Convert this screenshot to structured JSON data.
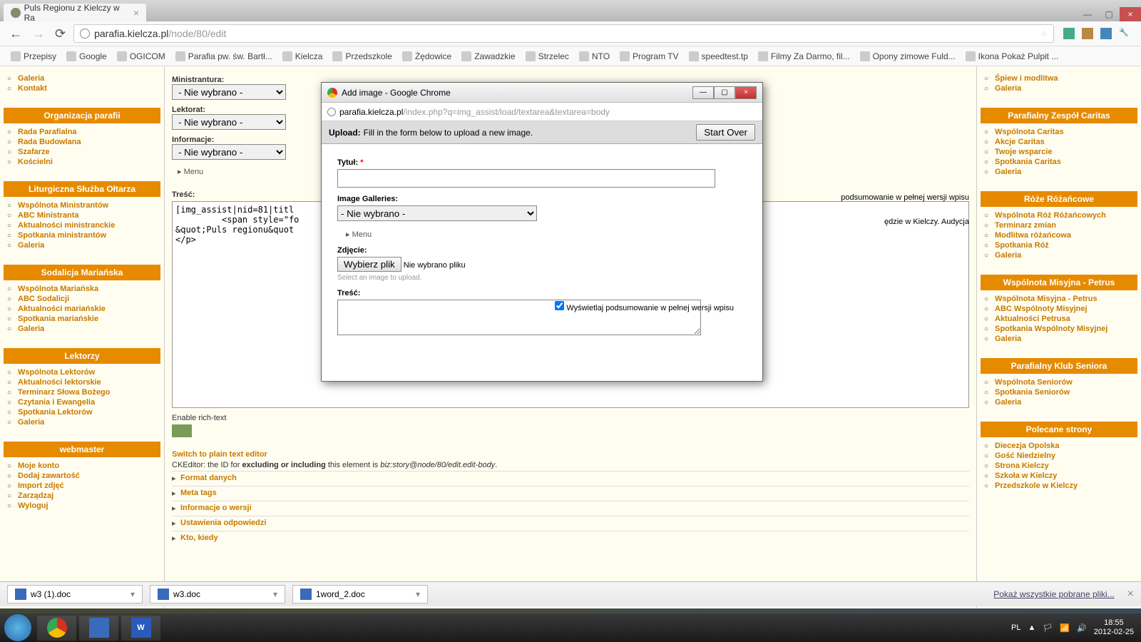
{
  "browser": {
    "tab_title": "Puls Regionu z Kielczy w Ra",
    "url_host": "parafia.kielcza.pl",
    "url_path": "/node/80/edit",
    "win_min": "—",
    "win_max": "▢",
    "win_close": "×"
  },
  "bookmarks": [
    "Przepisy",
    "Google",
    "OGICOM",
    "Parafia pw. św. Bartł...",
    "Kielcza",
    "Przedszkole",
    "Żędowice",
    "Zawadzkie",
    "Strzelec",
    "NTO",
    "Program TV",
    "speedtest.tp",
    "Filmy Za Darmo, fil...",
    "Opony zimowe Fuld...",
    "Ikona Pokaż Pulpit ..."
  ],
  "left": {
    "top_items": [
      "Galeria",
      "Kontakt"
    ],
    "sections": [
      {
        "title": "Organizacja parafii",
        "items": [
          "Rada Parafialna",
          "Rada Budowlana",
          "Szafarze",
          "Kościelni"
        ]
      },
      {
        "title": "Liturgiczna Służba Ołtarza",
        "items": [
          "Wspólnota Ministrantów",
          "ABC Ministranta",
          "Aktualności ministranckie",
          "Spotkania ministrantów",
          "Galeria"
        ]
      },
      {
        "title": "Sodalicja Mariańska",
        "items": [
          "Wspólnota Mariańska",
          "ABC Sodalicji",
          "Aktualności mariańskie",
          "Spotkania mariańskie",
          "Galeria"
        ]
      },
      {
        "title": "Lektorzy",
        "items": [
          "Wspólnota Lektorów",
          "Aktualności lektorskie",
          "Terminarz Słowa Bożego",
          "Czytania i Ewangelia",
          "Spotkania Lektorów",
          "Galeria"
        ]
      },
      {
        "title": "webmaster",
        "items": [
          "Moje konto",
          "Dodaj zawartość",
          "Import zdjęć",
          "Zarządzaj",
          "Wyloguj"
        ]
      }
    ]
  },
  "right": {
    "top_items": [
      "Śpiew i modlitwa",
      "Galeria"
    ],
    "sections": [
      {
        "title": "Parafialny Zespół Caritas",
        "items": [
          "Wspólnota Caritas",
          "Akcje Caritas",
          "Twoje wsparcie",
          "Spotkania Caritas",
          "Galeria"
        ]
      },
      {
        "title": "Róże Różańcowe",
        "items": [
          "Wspólnota Róż Różańcowych",
          "Terminarz zmian",
          "Modlitwa różańcowa",
          "Spotkania Róż",
          "Galeria"
        ]
      },
      {
        "title": "Wspólnota Misyjna - Petrus",
        "items": [
          "Wspólnota Misyjna - Petrus",
          "ABC Wspólnoty Misyjnej",
          "Aktualności Petrusa",
          "Spotkania Wspólnoty Misyjnej",
          "Galeria"
        ]
      },
      {
        "title": "Parafialny Klub Seniora",
        "items": [
          "Wspólnota Seniorów",
          "Spotkania Seniorów",
          "Galeria"
        ]
      },
      {
        "title": "Polecane strony",
        "items": [
          "Diecezja Opolska",
          "Gość Niedzielny",
          "Strona Kielczy",
          "Szkoła w Kielczy",
          "Przedszkole w Kielczy"
        ]
      }
    ]
  },
  "main": {
    "fields": [
      {
        "label": "Ministrantura:",
        "value": "- Nie wybrano -"
      },
      {
        "label": "Lektorat:",
        "value": "- Nie wybrano -"
      },
      {
        "label": "Informacje:",
        "value": "- Nie wybrano -"
      }
    ],
    "menu_label": "Menu",
    "tresc_label": "Treść:",
    "tresc_text": "[img_assist|nid=81|titl\n         <span style=\"fo\n&quot;Puls regionu&quot\n</p>",
    "side_text1": "podsumowanie w pełnej wersji wpisu",
    "side_text2": "ędzie w Kielczy. Audycja",
    "enable_rich": "Enable rich-text",
    "switch_plain": "Switch to plain text editor",
    "ck_prefix": "CKEditor: the ID for ",
    "ck_bold": "excluding or including",
    "ck_mid": " this element is ",
    "ck_em": "biz:story@node/80/edit.edit-body",
    "collapses": [
      "Format danych",
      "Meta tags",
      "Informacje o wersji",
      "Ustawienia odpowiedzi",
      "Kto, kiedy"
    ]
  },
  "popup": {
    "title": "Add image - Google Chrome",
    "url_host": "parafia.kielcza.pl",
    "url_path": "/index.php?q=img_assist/load/textarea&textarea=body",
    "upload": "Upload:",
    "upload_hint": "Fill in the form below to upload a new image.",
    "start_over": "Start Over",
    "tytul": "Tytuł:",
    "galleries": "Image Galleries:",
    "gallery_value": "- Nie wybrano -",
    "menu": "Menu",
    "zdjecie": "Zdjęcie:",
    "file_btn": "Wybierz plik",
    "file_status": "Nie wybrano pliku",
    "file_hint": "Select an image to upload.",
    "tresc": "Treść:",
    "chk_label": "Wyświetlaj podsumowanie w pełnej wersji wpisu"
  },
  "downloads": {
    "items": [
      "w3 (1).doc",
      "w3.doc",
      "1word_2.doc"
    ],
    "show_all": "Pokaż wszystkie pobrane pliki..."
  },
  "taskbar": {
    "lang": "PL",
    "time": "18:55",
    "date": "2012-02-25"
  }
}
